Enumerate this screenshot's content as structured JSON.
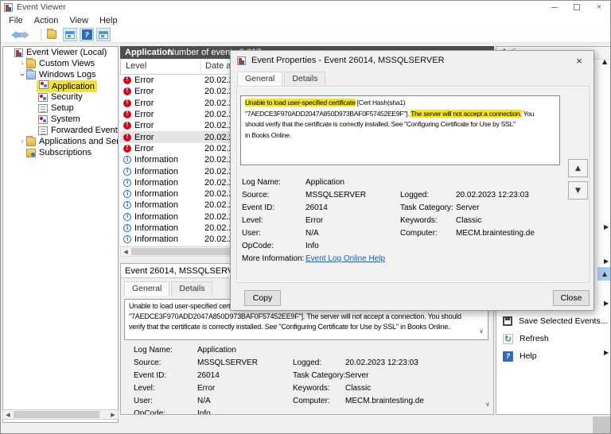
{
  "titlebar": {
    "title": "Event Viewer"
  },
  "menubar": {
    "items": [
      "File",
      "Action",
      "View",
      "Help"
    ]
  },
  "toolbar": {
    "icons": [
      "back",
      "forward",
      "separator",
      "folder",
      "console-window",
      "help",
      "action-pane"
    ]
  },
  "tree": {
    "items": [
      {
        "label": "Event Viewer (Local)",
        "icon": "app",
        "indent": 0,
        "expander": ""
      },
      {
        "label": "Custom Views",
        "icon": "folder",
        "indent": 1,
        "expander": "collapsed"
      },
      {
        "label": "Windows Logs",
        "icon": "folder-blue",
        "indent": 1,
        "expander": "expanded"
      },
      {
        "label": "Application",
        "icon": "log",
        "indent": 2,
        "expander": "",
        "highlighted": true
      },
      {
        "label": "Security",
        "icon": "log",
        "indent": 2,
        "expander": ""
      },
      {
        "label": "Setup",
        "icon": "page",
        "indent": 2,
        "expander": ""
      },
      {
        "label": "System",
        "icon": "log",
        "indent": 2,
        "expander": ""
      },
      {
        "label": "Forwarded Events",
        "icon": "page",
        "indent": 2,
        "expander": ""
      },
      {
        "label": "Applications and Services Lo",
        "icon": "folder",
        "indent": 1,
        "expander": "collapsed"
      },
      {
        "label": "Subscriptions",
        "icon": "subscriptions",
        "indent": 1,
        "expander": ""
      }
    ]
  },
  "list": {
    "title": "Application",
    "subtitle": "Number of events 9,617",
    "columns": [
      "Level",
      "Date and Time"
    ],
    "selected_index": 5,
    "rows": [
      {
        "level": "Error",
        "date": "20.02.2023"
      },
      {
        "level": "Error",
        "date": "20.02.2023"
      },
      {
        "level": "Error",
        "date": "20.02.2023"
      },
      {
        "level": "Error",
        "date": "20.02.2023"
      },
      {
        "level": "Error",
        "date": "20.02.2023"
      },
      {
        "level": "Error",
        "date": "20.02.2023"
      },
      {
        "level": "Error",
        "date": "20.02.2023"
      },
      {
        "level": "Information",
        "date": "20.02.2023"
      },
      {
        "level": "Information",
        "date": "20.02.2023"
      },
      {
        "level": "Information",
        "date": "20.02.2023"
      },
      {
        "level": "Information",
        "date": "20.02.2023"
      },
      {
        "level": "Information",
        "date": "20.02.2023"
      },
      {
        "level": "Information",
        "date": "20.02.2023"
      },
      {
        "level": "Information",
        "date": "20.02.2023"
      },
      {
        "level": "Information",
        "date": "20.02.2023"
      }
    ]
  },
  "preview": {
    "header": "Event 26014, MSSQLSERVER",
    "tabs": [
      "General",
      "Details"
    ],
    "active_tab": "General",
    "message": "Unable to load user-specified certificate [Cert Hash(sha1) \"7AEDCE3F970ADD2047A850D973BAF0F57452EE9F\"]. The server will not accept a connection. You should verify that the certificate is correctly installed. See \"Configuring Certificate for Use by SSL\" in Books Online."
  },
  "event": {
    "fields_left": [
      {
        "label": "Log Name:",
        "value": "Application"
      },
      {
        "label": "Source:",
        "value": "MSSQLSERVER"
      },
      {
        "label": "Event ID:",
        "value": "26014"
      },
      {
        "label": "Level:",
        "value": "Error"
      },
      {
        "label": "User:",
        "value": "N/A"
      },
      {
        "label": "OpCode:",
        "value": "Info"
      }
    ],
    "fields_right": [
      {
        "label": "Logged:",
        "value": "20.02.2023 12:23:03"
      },
      {
        "label": "Task Category:",
        "value": "Server"
      },
      {
        "label": "Keywords:",
        "value": "Classic"
      },
      {
        "label": "Computer:",
        "value": "MECM.braintesting.de"
      }
    ],
    "more_info_label": "More Information:",
    "more_info_link": "Event Log Online Help"
  },
  "dialog": {
    "title": "Event Properties - Event 26014, MSSQLSERVER",
    "tabs": [
      "General",
      "Details"
    ],
    "active_tab": "General",
    "message_segments": [
      {
        "text": "Unable to load user-specified certificate",
        "highlight": true
      },
      {
        "text": " [Cert Hash(sha1)",
        "highlight": false,
        "break_after": true
      },
      {
        "text": "\"7AEDCE3F970ADD2047A850D973BAF0F57452EE9F\"]. ",
        "highlight": false
      },
      {
        "text": "The server will not accept a connection.",
        "highlight": true
      },
      {
        "text": " You",
        "highlight": false,
        "break_after": true
      },
      {
        "text": "should verify that the certificate is correctly installed. See \"Configuring Certificate for Use by SSL\"",
        "highlight": false,
        "break_after": true
      },
      {
        "text": "in Books Online.",
        "highlight": false
      }
    ],
    "copy_label": "Copy",
    "close_label": "Close"
  },
  "actions": {
    "header": "Actions",
    "items": [
      {
        "label": "Save Selected Events...",
        "icon": "save"
      },
      {
        "label": "Refresh",
        "icon": "refresh"
      },
      {
        "label": "Help",
        "icon": "help",
        "expander": true
      }
    ]
  },
  "colors": {
    "highlighter_yellow": "#f3e13a",
    "error_red": "#c50f1f",
    "info_blue": "#1a66b8",
    "link_blue": "#0a64c8",
    "header_gray": "#4f4f4f",
    "selection_blue": "#a9cdf1"
  }
}
